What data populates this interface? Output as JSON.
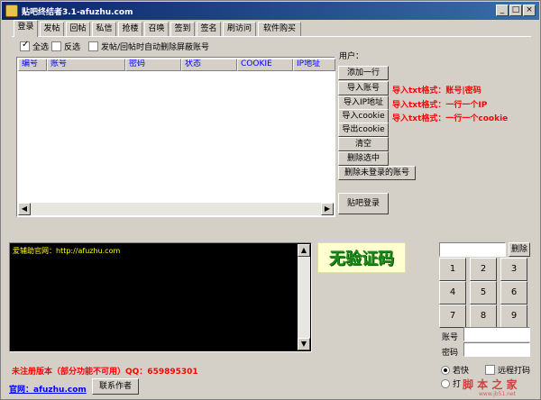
{
  "window": {
    "title": "贴吧终结者3.1-afuzhu.com",
    "min_label": "_",
    "max_label": "□",
    "close_label": "×"
  },
  "tabs": [
    "登录",
    "发帖",
    "回帖",
    "私信",
    "抢楼",
    "召唤",
    "签到",
    "签名",
    "刷访问",
    "软件购买"
  ],
  "options": {
    "select_all": "全选",
    "invert": "反选",
    "auto_delete": "发帖/回帖时自动删除屏蔽账号",
    "select_all_checked": true,
    "invert_checked": false,
    "auto_delete_checked": false
  },
  "table": {
    "columns": [
      "编号",
      "账号",
      "密码",
      "状态",
      "COOKIE",
      "IP地址"
    ]
  },
  "user_label": "用户：",
  "buttons": {
    "add_row": "添加一行",
    "import_account": "导入账号",
    "import_ip": "导入IP地址",
    "import_cookie": "导入cookie",
    "export_cookie": "导出cookie",
    "clear": "清空",
    "delete_selected": "删除选中",
    "delete_unlogged": "删除未登录的账号",
    "tieba_login": "贴吧登录",
    "delete": "删除",
    "contact": "联系作者"
  },
  "hints": {
    "account": "导入txt格式：账号|密码",
    "ip": "导入txt格式：一行一个IP",
    "cookie": "导入txt格式：一行一个cookie"
  },
  "console_text": "爱辅助官网：http://afuzhu.com",
  "captcha_badge": "无验证码",
  "keypad": [
    "1",
    "2",
    "3",
    "4",
    "5",
    "6",
    "7",
    "8",
    "9"
  ],
  "fields": {
    "account_label": "账号",
    "password_label": "密码"
  },
  "radios": {
    "opt1": "若快",
    "opt2": "打",
    "opt1_selected": true,
    "opt2_selected": false
  },
  "remote_captcha": {
    "label": "远程打码",
    "checked": false
  },
  "footer": {
    "unregistered": "未注册版本（部分功能不可用）QQ：659895301",
    "website": "官网：afuzhu.com",
    "watermark": "脚 本 之 家",
    "watermark_url": "www.jb51.net"
  },
  "colors": {
    "title_start": "#0a246a",
    "title_end": "#3a6ea5",
    "hint_red": "#ff0000",
    "header_blue": "#0000ff",
    "console_yellow": "#ffff00",
    "badge_green": "#1a8a1a"
  }
}
